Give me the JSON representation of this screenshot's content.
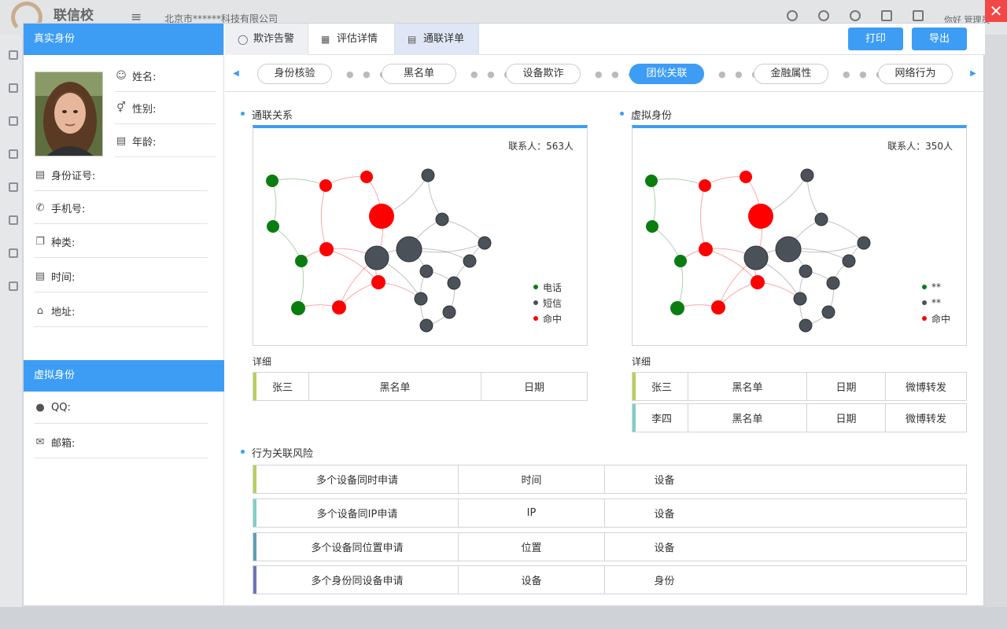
{
  "app": {
    "brand": "联信校",
    "menu_glyph": "≡",
    "company": "北京市******科技有限公司",
    "greeting": "你好 管理员"
  },
  "close_glyph": "✕",
  "left": {
    "real_identity_title": "真实身份",
    "fields": {
      "name": "姓名:",
      "gender": "性别:",
      "age": "年龄:",
      "id_number": "身份证号:",
      "phone": "手机号:",
      "type": "种类:",
      "time": "时间:",
      "address": "地址:"
    },
    "virtual_identity_title": "虚拟身份",
    "virtual_fields": {
      "qq": "QQ:",
      "email": "邮箱:"
    }
  },
  "tabs": [
    {
      "label": "欺诈告警",
      "icon": "alarm-icon"
    },
    {
      "label": "评估详情",
      "icon": "chart-icon"
    },
    {
      "label": "通联详单",
      "icon": "document-icon"
    }
  ],
  "actions": {
    "print": "打印",
    "export": "导出"
  },
  "steps": [
    "身份核验",
    "黑名单",
    "设备欺诈",
    "团伙关联",
    "金融属性",
    "网络行为"
  ],
  "active_step": "团伙关联",
  "sections": {
    "contact_relation": {
      "title": "通联关系",
      "contacts": "联系人：563人",
      "legend": [
        {
          "label": "电话",
          "color": "#0a7d10"
        },
        {
          "label": "短信",
          "color": "#4a5159"
        },
        {
          "label": "命中",
          "color": "#ff0000"
        }
      ],
      "detail_title": "详细",
      "rows": [
        [
          "张三",
          "黑名单",
          "日期"
        ]
      ]
    },
    "virtual_identity": {
      "title": "虚拟身份",
      "contacts": "联系人：350人",
      "legend": [
        {
          "label": "**",
          "color": "#0a7d10"
        },
        {
          "label": "**",
          "color": "#4a5159"
        },
        {
          "label": "命中",
          "color": "#ff0000"
        }
      ],
      "detail_title": "详细",
      "rows": [
        [
          "张三",
          "黑名单",
          "日期",
          "微博转发"
        ],
        [
          "李四",
          "黑名单",
          "日期",
          "微博转发"
        ]
      ]
    },
    "behavior_risk": {
      "title": "行为关联风险",
      "rows": [
        [
          "多个设备同时申请",
          "时间",
          "设备"
        ],
        [
          "多个设备同IP申请",
          "IP",
          "设备"
        ],
        [
          "多个设备同位置申请",
          "位置",
          "设备"
        ],
        [
          "多个身份同设备申请",
          "设备",
          "身份"
        ]
      ]
    }
  },
  "colors": {
    "accent": "#3d9df5",
    "phone": "#0a7d10",
    "sms": "#4a5159",
    "hit": "#ff0000",
    "row_bars": [
      "#b8cf5a",
      "#7fcfc6",
      "#5d9fb3",
      "#6d77b3"
    ]
  }
}
